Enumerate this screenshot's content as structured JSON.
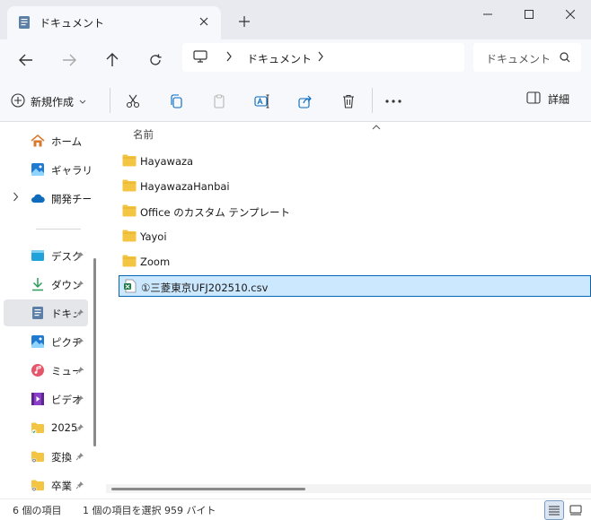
{
  "tab": {
    "title": "ドキュメント"
  },
  "address": {
    "location": "ドキュメント"
  },
  "search": {
    "placeholder": "ドキュメント"
  },
  "toolbar": {
    "new_label": "新規作成",
    "details_label": "詳細"
  },
  "sidebar": {
    "items": [
      {
        "label": "ホーム",
        "icon": "home-icon"
      },
      {
        "label": "ギャラリー",
        "icon": "gallery-icon"
      },
      {
        "label": "開発チーム",
        "icon": "cloud-icon"
      },
      {
        "label": "デスクトップ",
        "icon": "desktop-icon"
      },
      {
        "label": "ダウンロード",
        "icon": "download-icon"
      },
      {
        "label": "ドキュメント",
        "icon": "document-icon"
      },
      {
        "label": "ピクチャ",
        "icon": "pictures-icon"
      },
      {
        "label": "ミュージック",
        "icon": "music-icon"
      },
      {
        "label": "ビデオ",
        "icon": "video-icon"
      },
      {
        "label": "2025",
        "icon": "folder-icon"
      },
      {
        "label": "変換",
        "icon": "folder-icon"
      },
      {
        "label": "卒業",
        "icon": "folder-icon"
      }
    ]
  },
  "list": {
    "column_name": "名前",
    "files": [
      {
        "name": "Hayawaza",
        "type": "folder"
      },
      {
        "name": "HayawazaHanbai",
        "type": "folder"
      },
      {
        "name": "Office のカスタム テンプレート",
        "type": "folder"
      },
      {
        "name": "Yayoi",
        "type": "folder"
      },
      {
        "name": "Zoom",
        "type": "folder"
      },
      {
        "name": "①三菱東京UFJ202510.csv",
        "type": "csv"
      }
    ]
  },
  "status": {
    "item_count": "6 個の項目",
    "selection": "1 個の項目を選択  959 バイト"
  },
  "colors": {
    "folder": "#f4c542",
    "selection_bg": "#cce8ff",
    "selection_border": "#0a64b4",
    "accent": "#0067c0"
  }
}
